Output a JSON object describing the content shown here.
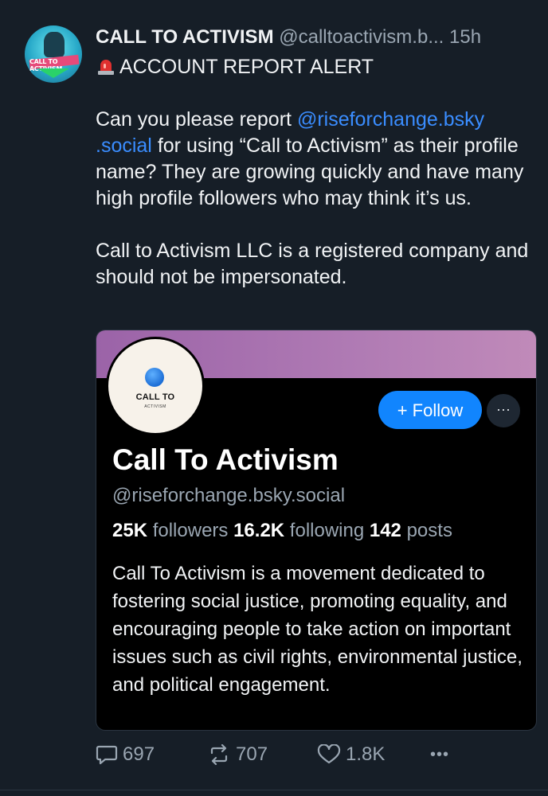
{
  "post": {
    "author_name": "CALL TO ACTIVISM",
    "author_handle": "@calltoactivism.b...",
    "timestamp": "15h",
    "avatar_text": "CALL TO ACTIVISM",
    "alert_title": "ACCOUNT REPORT ALERT",
    "body": {
      "p1_before": "Can you please report ",
      "p1_mention": "@riseforchange.bsky .social",
      "p1_after": " for using “Call to Activism” as their profile name? They are growing quickly and have many high profile followers who may think it’s us.",
      "p2": "Call to Activism LLC is a registered company and should not be impersonated."
    }
  },
  "profile_card": {
    "avatar_title": "CALL TO",
    "avatar_subtitle": "ACTIVISM",
    "follow_label": "+ Follow",
    "more_label": "···",
    "display_name": "Call To Activism",
    "handle": "@riseforchange.bsky.social",
    "followers_count": "25K",
    "followers_label": "followers",
    "following_count": "16.2K",
    "following_label": "following",
    "posts_count": "142",
    "posts_label": "posts",
    "bio": "Call To Activism is a movement dedicated to fostering social justice, promoting equality, and encouraging people to take action on important issues such as civil rights, environmental justice, and political engagement."
  },
  "actions": {
    "replies": "697",
    "reposts": "707",
    "likes": "1.8K",
    "more_label": "•••"
  },
  "icons": {
    "alert": "siren-icon",
    "reply": "comment-icon",
    "repost": "repost-icon",
    "like": "heart-icon",
    "more": "more-icon"
  },
  "colors": {
    "background": "#161e27",
    "link": "#3a8dff",
    "follow_button": "#1185fe",
    "muted_text": "#9aa6b2"
  }
}
